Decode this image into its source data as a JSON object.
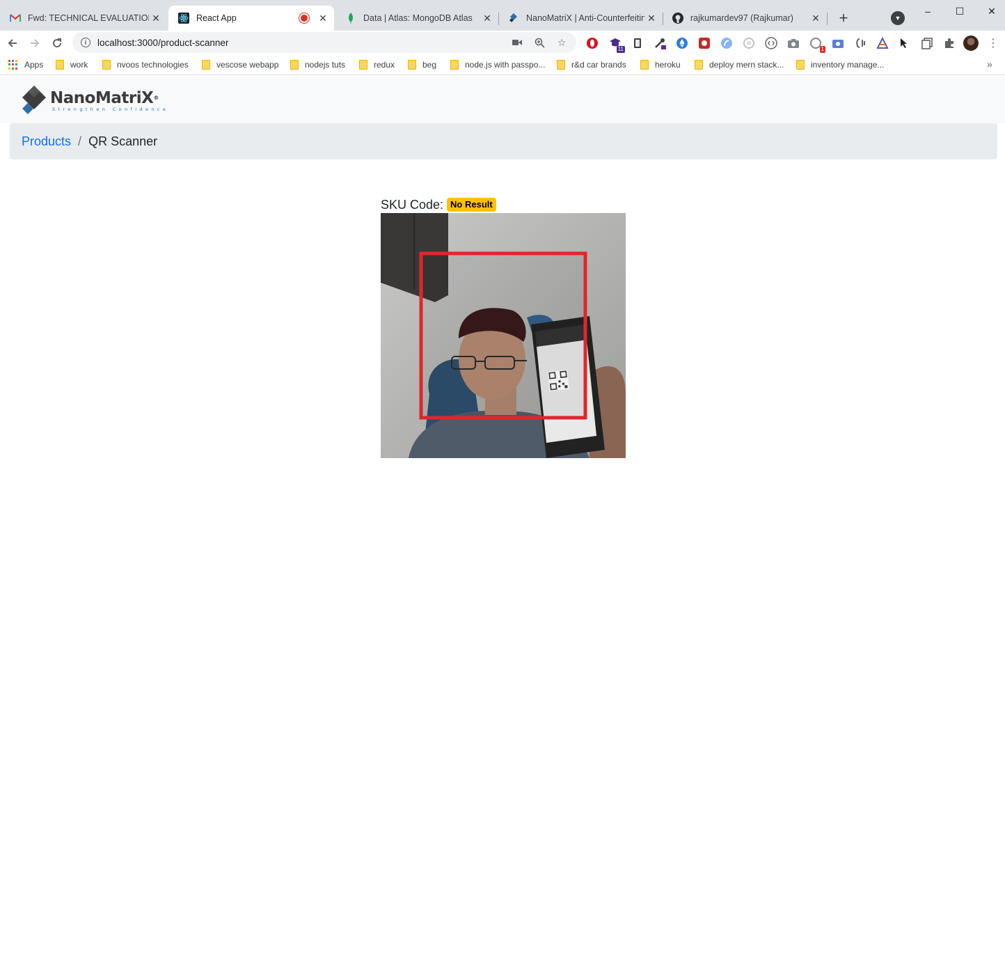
{
  "browser": {
    "tabs": [
      {
        "title": "Fwd: TECHNICAL EVALUATION E",
        "icon": "gmail-icon"
      },
      {
        "title": "React App",
        "icon": "react-icon",
        "active": true,
        "recording": true
      },
      {
        "title": "Data | Atlas: MongoDB Atlas",
        "icon": "mongodb-leaf-icon"
      },
      {
        "title": "NanoMatriX | Anti-Counterfeiting",
        "icon": "nanomatrix-icon"
      },
      {
        "title": "rajkumardev97 (Rajkumar)",
        "icon": "github-icon"
      }
    ],
    "new_tab_symbol": "+",
    "window_controls": {
      "minimize": "–",
      "maximize": "☐",
      "close": "✕"
    },
    "address_bar": {
      "url": "localhost:3000/product-scanner"
    },
    "bookmarks": [
      {
        "label": "Apps",
        "type": "apps"
      },
      {
        "label": "work",
        "type": "folder"
      },
      {
        "label": "nvoos technologies",
        "type": "folder"
      },
      {
        "label": "vescose webapp",
        "type": "folder"
      },
      {
        "label": "nodejs tuts",
        "type": "folder"
      },
      {
        "label": "redux",
        "type": "folder"
      },
      {
        "label": "beg",
        "type": "folder"
      },
      {
        "label": "node.js with passpo...",
        "type": "folder"
      },
      {
        "label": "r&d car brands",
        "type": "folder"
      },
      {
        "label": "heroku",
        "type": "folder"
      },
      {
        "label": "deploy mern stack...",
        "type": "folder"
      },
      {
        "label": "inventory manage...",
        "type": "folder"
      }
    ],
    "extension_badges": {
      "ext_11": "11",
      "ext_1": "1"
    }
  },
  "app": {
    "brand": {
      "name": "NanoMatriX",
      "registered": "®",
      "tagline": "Strengthen Confidence"
    },
    "breadcrumb": {
      "parent": "Products",
      "separator": "/",
      "current": "QR Scanner"
    },
    "scanner": {
      "label": "SKU Code:",
      "status": "No Result",
      "status_color": "#ffc107",
      "frame_color": "#e0262c"
    }
  }
}
